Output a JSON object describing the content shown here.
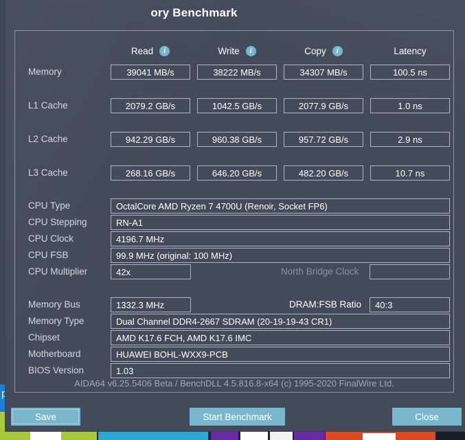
{
  "window": {
    "title": "ory Benchmark"
  },
  "columns": {
    "read": {
      "label": "Read",
      "info_icon": "info-icon",
      "has_info": true
    },
    "write": {
      "label": "Write",
      "info_icon": "info-icon",
      "has_info": true
    },
    "copy": {
      "label": "Copy",
      "info_icon": "info-icon",
      "has_info": true
    },
    "latency": {
      "label": "Latency",
      "has_info": false
    }
  },
  "benchmark_rows": [
    {
      "label": "Memory",
      "read": "39041 MB/s",
      "write": "38222 MB/s",
      "copy": "34307 MB/s",
      "latency": "100.5 ns"
    },
    {
      "label": "L1 Cache",
      "read": "2079.2 GB/s",
      "write": "1042.5 GB/s",
      "copy": "2077.9 GB/s",
      "latency": "1.0 ns"
    },
    {
      "label": "L2 Cache",
      "read": "942.29 GB/s",
      "write": "960.38 GB/s",
      "copy": "957.72 GB/s",
      "latency": "2.9 ns"
    },
    {
      "label": "L3 Cache",
      "read": "268.16 GB/s",
      "write": "646.20 GB/s",
      "copy": "482.20 GB/s",
      "latency": "10.7 ns"
    }
  ],
  "cpu_info": {
    "cpu_type_label": "CPU Type",
    "cpu_type_value": "OctalCore AMD Ryzen 7 4700U  (Renoir, Socket FP6)",
    "cpu_stepping_label": "CPU Stepping",
    "cpu_stepping_value": "RN-A1",
    "cpu_clock_label": "CPU Clock",
    "cpu_clock_value": "4196.7 MHz",
    "cpu_fsb_label": "CPU FSB",
    "cpu_fsb_value": "99.9 MHz  (original: 100 MHz)",
    "cpu_multiplier_label": "CPU Multiplier",
    "cpu_multiplier_value": "42x",
    "north_bridge_clock_label": "North Bridge Clock",
    "north_bridge_clock_value": ""
  },
  "memory_info": {
    "memory_bus_label": "Memory Bus",
    "memory_bus_value": "1332.3 MHz",
    "dram_fsb_ratio_label": "DRAM:FSB Ratio",
    "dram_fsb_ratio_value": "40:3",
    "memory_type_label": "Memory Type",
    "memory_type_value": "Dual Channel DDR4-2667 SDRAM  (20-19-19-43 CR1)",
    "chipset_label": "Chipset",
    "chipset_value": "AMD K17.6 FCH, AMD K17.6 IMC",
    "motherboard_label": "Motherboard",
    "motherboard_value": "HUAWEI BOHL-WXX9-PCB",
    "bios_version_label": "BIOS Version",
    "bios_version_value": "1.03"
  },
  "copyright": "AIDA64 v6.25.5406 Beta / BenchDLL 4.5.816.8-x64  (c) 1995-2020 FinalWire Ltd.",
  "buttons": {
    "save": "Save",
    "start_benchmark": "Start Benchmark",
    "close": "Close"
  },
  "desktop": {
    "tile_letter": "p"
  },
  "colors": {
    "dialog_background": "#434a59",
    "desktop_background": "#3f4654",
    "button": "#79b8cc",
    "info_icon": "#76b7c9",
    "field_border": "#aeb5c1",
    "label_text": "#d3d7de",
    "dim_text": "#8b93a1"
  }
}
